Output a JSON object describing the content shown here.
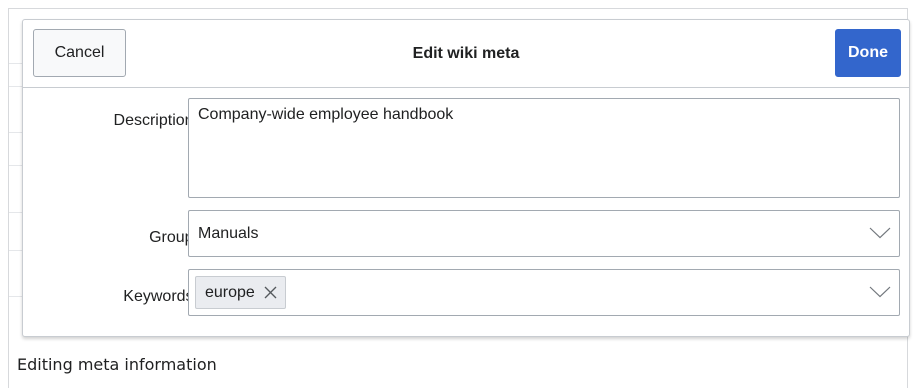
{
  "dialog": {
    "title": "Edit wiki meta",
    "cancel_label": "Cancel",
    "done_label": "Done",
    "accent_color": "#3366cc"
  },
  "fields": {
    "description": {
      "label": "Description:",
      "value": "Company-wide employee handbook"
    },
    "group": {
      "label": "Group:",
      "value": "Manuals",
      "icon": "chevron-down-icon"
    },
    "keywords": {
      "label": "Keywords:",
      "tags": [
        "europe"
      ],
      "remove_icon": "close-icon",
      "icon": "chevron-down-icon"
    }
  },
  "caption": "Editing meta information"
}
